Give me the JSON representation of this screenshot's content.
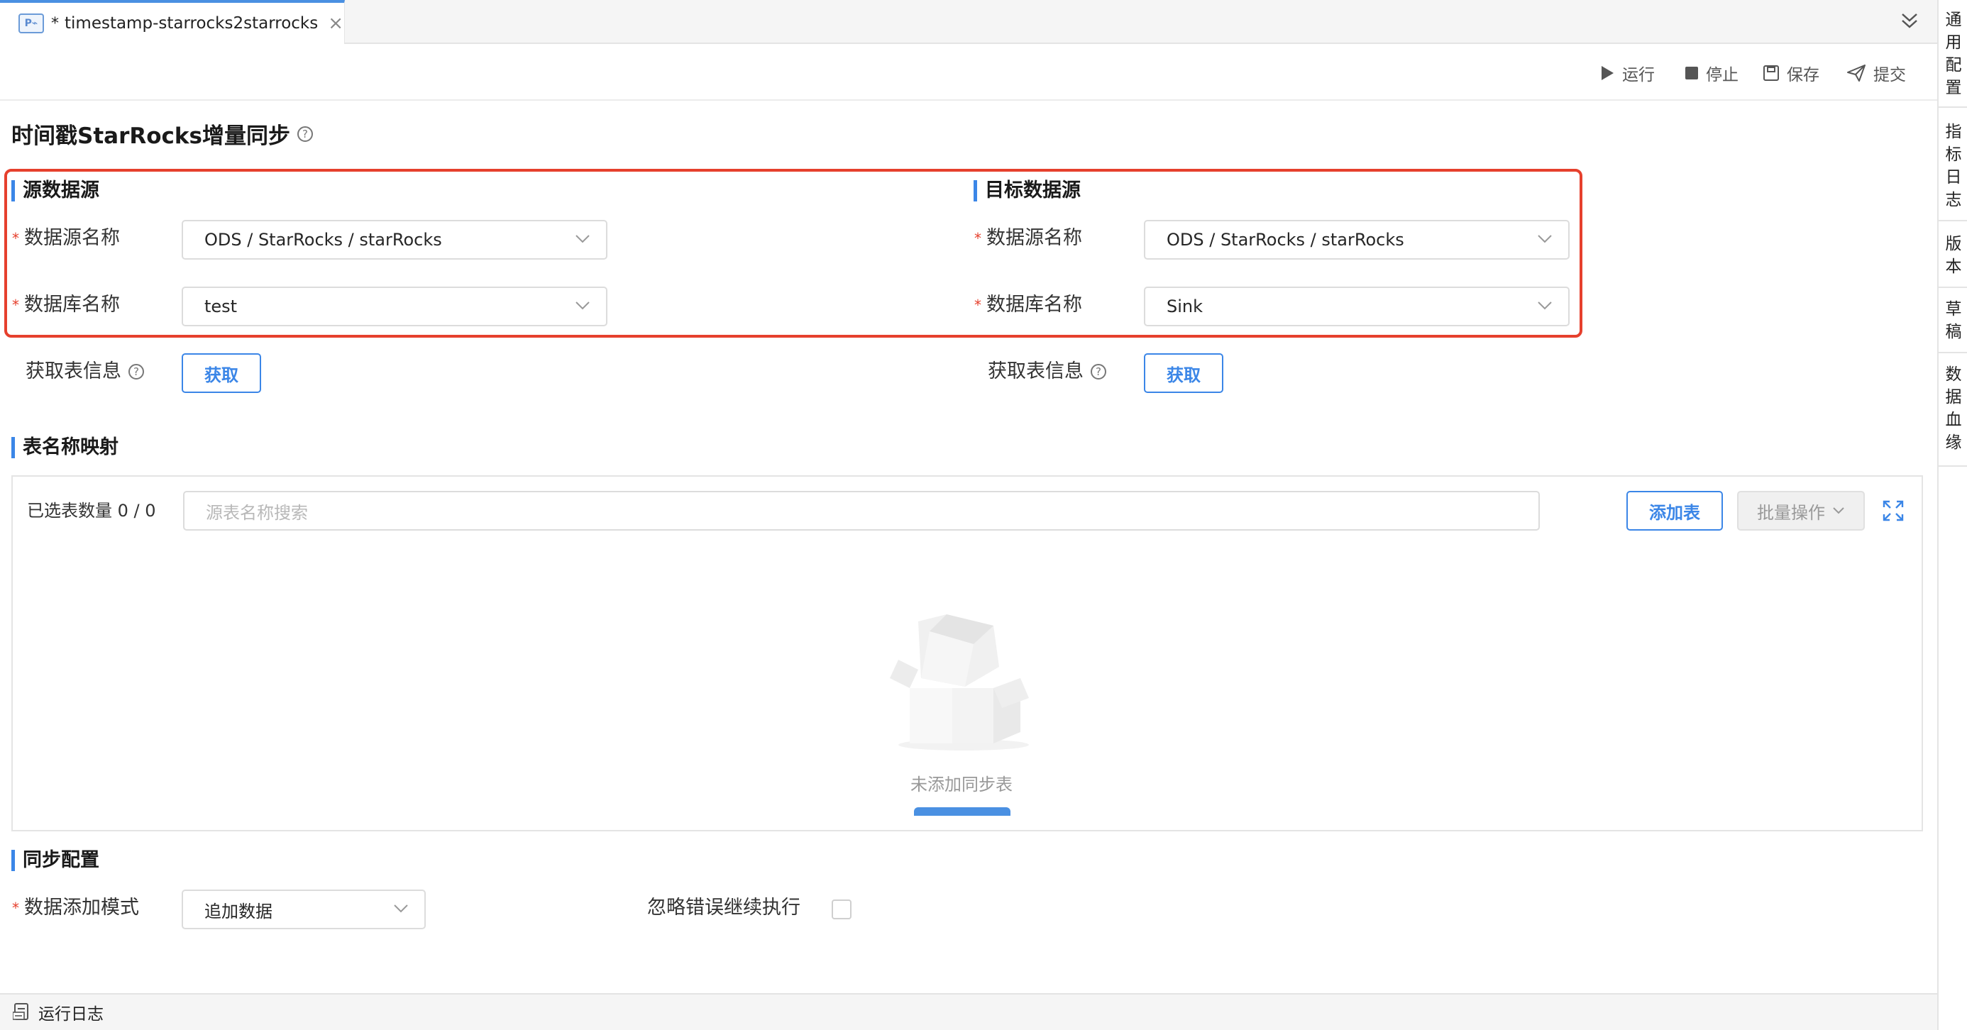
{
  "tab": {
    "icon_label": "P⌁",
    "modified_marker": "*",
    "title": "timestamp-starrocks2starrocks",
    "close_glyph": "×"
  },
  "right_sidebar": {
    "items": [
      {
        "chars": [
          "通",
          "用",
          "配",
          "置"
        ]
      },
      {
        "chars": [
          "指",
          "标",
          "日",
          "志"
        ]
      },
      {
        "chars": [
          "版",
          "本"
        ]
      },
      {
        "chars": [
          "草",
          "稿"
        ]
      },
      {
        "chars": [
          "数",
          "据",
          "血",
          "缘"
        ]
      }
    ]
  },
  "toolbar": {
    "run": "运行",
    "stop": "停止",
    "save": "保存",
    "submit": "提交"
  },
  "page": {
    "title": "时间戳StarRocks增量同步",
    "help": "?"
  },
  "source": {
    "section_title": "源数据源",
    "datasource_label": "数据源名称",
    "datasource_value": "ODS / StarRocks / starRocks",
    "database_label": "数据库名称",
    "database_value": "test",
    "fetch_label": "获取表信息",
    "fetch_button": "获取"
  },
  "target": {
    "section_title": "目标数据源",
    "datasource_label": "数据源名称",
    "datasource_value": "ODS / StarRocks / starRocks",
    "database_label": "数据库名称",
    "database_value": "Sink",
    "fetch_label": "获取表信息",
    "fetch_button": "获取"
  },
  "required_marker": "*",
  "mapping": {
    "section_title": "表名称映射",
    "selected_count": "已选表数量 0 / 0",
    "search_placeholder": "源表名称搜索",
    "add_table_button": "添加表",
    "batch_button": "批量操作",
    "empty_text": "未添加同步表"
  },
  "sync_config": {
    "section_title": "同步配置",
    "mode_label": "数据添加模式",
    "mode_value": "追加数据",
    "ignore_errors_label": "忽略错误继续执行",
    "ignore_errors_checked": false
  },
  "bottom": {
    "run_log": "运行日志"
  },
  "colors": {
    "accent": "#3b86e7",
    "highlight": "#e6402d",
    "required": "#e6402d"
  }
}
